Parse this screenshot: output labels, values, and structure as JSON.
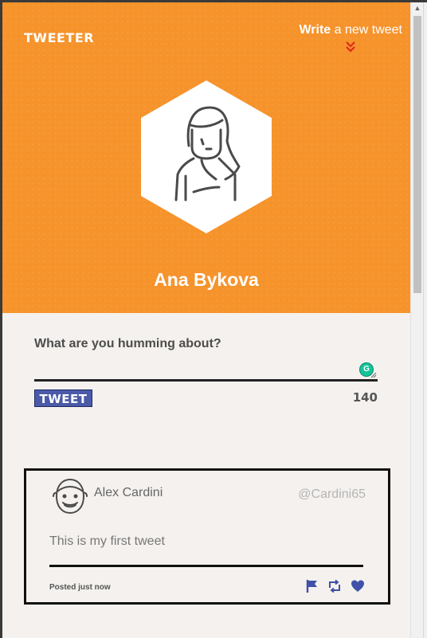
{
  "header": {
    "brand": "TWEETER",
    "write_bold": "Write",
    "write_rest": " a new tweet",
    "profile_name": "Ana Bykova",
    "avatar_icon": "woman-avatar-icon",
    "bg_color": "#f6932b"
  },
  "compose": {
    "label": "What are you humming about?",
    "input_value": "",
    "grammarly_badge": "G",
    "tweet_button": "TWEET",
    "char_count": "140"
  },
  "tweets": [
    {
      "name": "Alex Cardini",
      "handle": "@Cardini65",
      "text": "This is my first tweet",
      "time": "Posted just now",
      "actions": [
        "flag-icon",
        "retweet-icon",
        "heart-icon"
      ]
    }
  ],
  "colors": {
    "accent": "#f6932b",
    "button": "#4b5aa8",
    "action_icons": "#3f51a8"
  }
}
